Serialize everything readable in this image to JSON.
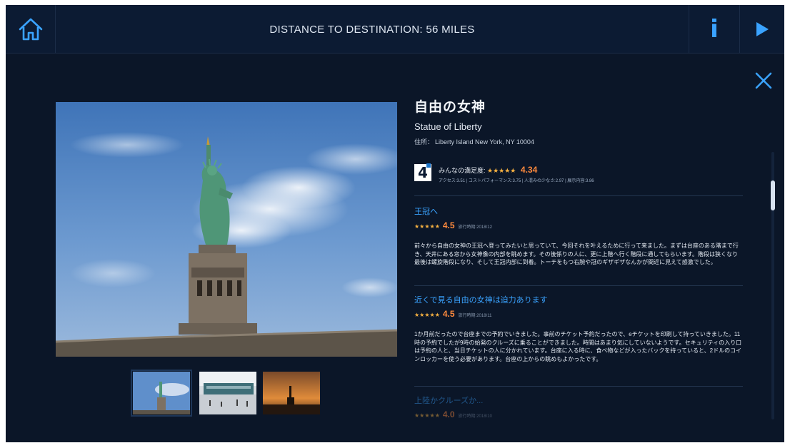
{
  "header": {
    "title": "DISTANCE TO DESTINATION: 56 MILES"
  },
  "icons": {
    "home": "home-icon",
    "info": "i",
    "play": "play-icon",
    "close": "close-icon"
  },
  "colors": {
    "accent": "#3aa3ff",
    "score": "#ff8a3d",
    "star": "#f5b041",
    "background": "#0b1628",
    "header": "#0c1b33"
  },
  "place": {
    "name_ja": "自由の女神",
    "name_en": "Statue of Liberty",
    "address_label": "住所：",
    "address": "Liberty Island New York, NY 10004"
  },
  "rating": {
    "badge": "4",
    "label": "みんなの満足度:",
    "stars": "★★★★★",
    "score": "4.34",
    "breakdown": "アクセス:3.51 | コストパフォーマンス:3.75 | 人混みの少なさ:2.97 | 展示内容:3.86"
  },
  "reviews": [
    {
      "title": "王冠へ",
      "stars": "★★★★★",
      "score": "4.5",
      "date": "旅行時期:2018/12",
      "body": "前々から自由の女神の王冠へ登ってみたいと思っていて、今回それを叶えるために行って来ました。まずは台座のある階まで行き、天井にある窓から女神像の内部を眺めます。その後係りの人に、更に上階へ行く階段に通してもらいます。階段は狭くなり最後は螺旋階段になり、そして王冠内部に到着。トーチをもつ右腕や冠のギザギザなんかが間近に見えて感激でした。"
    },
    {
      "title": "近くで見る自由の女神は迫力あります",
      "stars": "★★★★★",
      "score": "4.5",
      "date": "旅行時期:2018/11",
      "body": "1か月前だったので台座までの予約でいきました。事前のチケット予約だったので、eチケットを印刷して持っていきました。11時の予約でしたが9時の始発のクルーズに乗ることができました。時間はあまり気にしていないようです。セキュリティの入り口は予約の人と、当日チケットの人に分かれています。台座に入る時に、食べ物などが入ったバックを持っていると、2ドルのコインロッカーを使う必要があります。台座の上からの眺めもよかったです。"
    },
    {
      "title": "上陸かクルーズか...",
      "stars": "★★★★★",
      "score": "4.0",
      "date": "旅行時期:2018/10",
      "body": ""
    }
  ],
  "gallery": {
    "thumbnails": [
      "statue-thumbnail",
      "ferry-thumbnail",
      "sunset-thumbnail"
    ]
  }
}
